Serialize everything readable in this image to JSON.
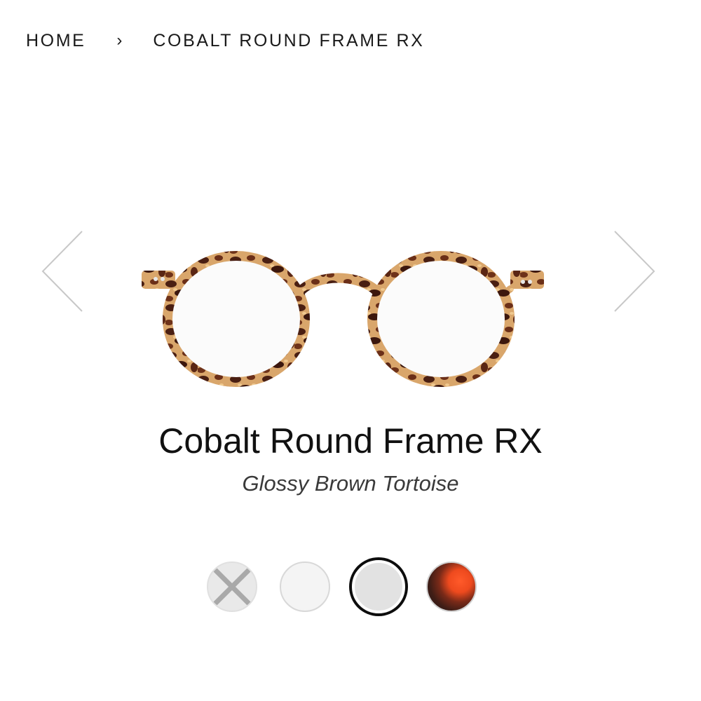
{
  "breadcrumb": {
    "home": "HOME",
    "separator": "›",
    "current": "COBALT ROUND FRAME RX"
  },
  "carousel": {
    "prev_icon": "chevron-left-icon",
    "next_icon": "chevron-right-icon"
  },
  "product": {
    "name": "Cobalt Round Frame RX",
    "color_name": "Glossy Brown Tortoise"
  },
  "swatches": [
    {
      "color": "#e9e9e9",
      "state": "unavailable"
    },
    {
      "color": "#f4f4f4",
      "state": "available"
    },
    {
      "color": "#e2e2e2",
      "state": "selected"
    },
    {
      "color": "#e8461c",
      "state": "available"
    }
  ],
  "colors": {
    "tortoise_dark": "#4a1f12",
    "tortoise_light": "#d8a36a",
    "text": "#111111",
    "subtitle": "#3a3a3a",
    "arrow": "#c8c8c8"
  }
}
